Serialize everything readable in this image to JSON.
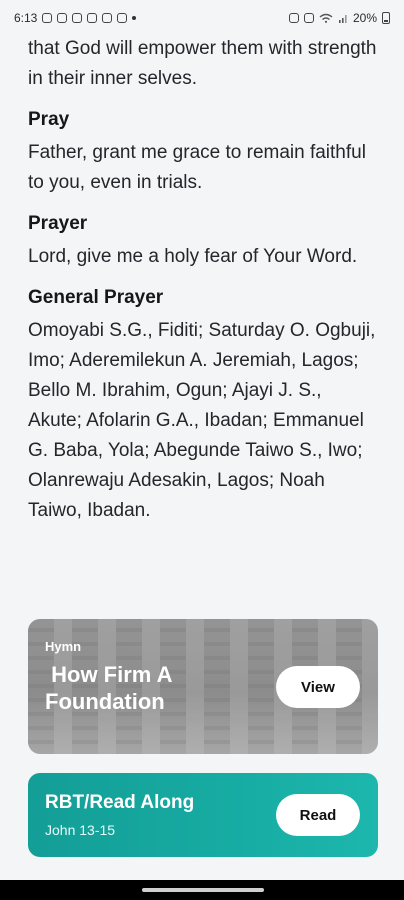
{
  "status_bar": {
    "time": "6:13",
    "battery": "20%"
  },
  "body": {
    "intro_text": "that God will empower them with strength in their inner selves.",
    "sections": [
      {
        "heading": "Pray",
        "text": "Father, grant me grace to remain faithful to you, even in trials."
      },
      {
        "heading": "Prayer",
        "text": "Lord, give me a holy fear of Your Word."
      },
      {
        "heading": "General Prayer",
        "text": "Omoyabi S.G., Fiditi; Saturday O. Ogbuji, Imo; Aderemilekun A. Jeremiah, Lagos; Bello M. Ibrahim, Ogun; Ajayi J. S., Akute; Afolarin G.A., Ibadan; Emmanuel G. Baba, Yola; Abegunde Taiwo S., Iwo; Olanrewaju Adesakin, Lagos; Noah Taiwo, Ibadan."
      }
    ]
  },
  "hymn_card": {
    "tag": "Hymn",
    "title": " How Firm A Foundation",
    "button_label": "View"
  },
  "read_card": {
    "title": "RBT/Read Along",
    "subtitle": "John 13-15",
    "button_label": "Read"
  },
  "colors": {
    "hymn_bg": "#8f8f8f",
    "read_bg": "#17aca3",
    "page_bg": "#f4f5f7"
  }
}
